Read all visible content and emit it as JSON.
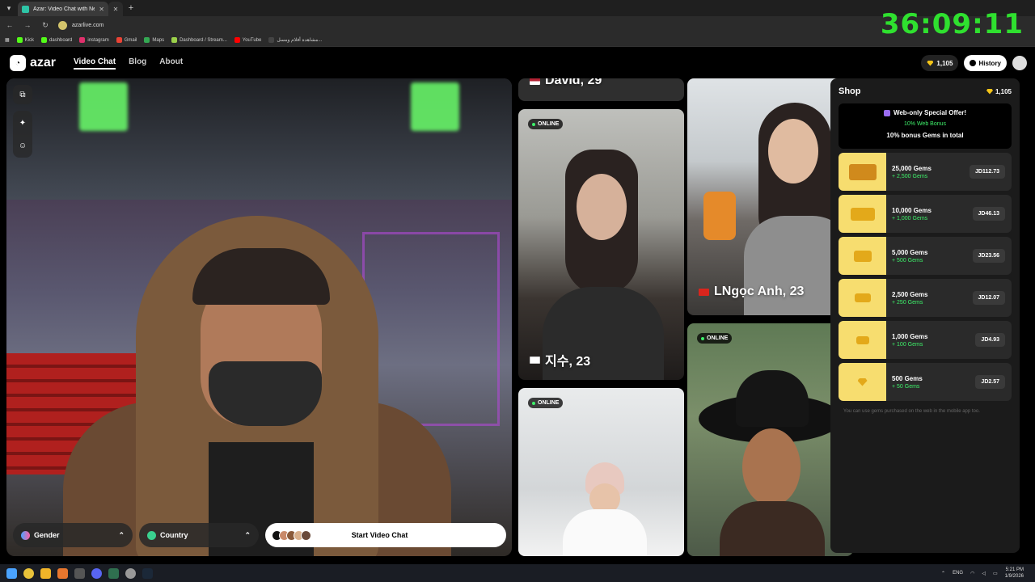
{
  "browser": {
    "tab_title": "Azar: Video Chat with New",
    "url": "azarlive.com",
    "bookmarks": [
      "Kick",
      "dashboard",
      "instagram",
      "Gmail",
      "Maps",
      "Dashboard / Stream...",
      "YouTube",
      "مشاهدة أفلام ومسل..."
    ]
  },
  "overlay_timer": "36:09:11",
  "site": {
    "logo": "azar",
    "nav": [
      "Video Chat",
      "Blog",
      "About"
    ],
    "gem_balance": "1,105",
    "history_label": "History"
  },
  "video": {
    "gender_label": "Gender",
    "country_label": "Country",
    "start_label": "Start Video Chat"
  },
  "profiles": [
    {
      "name": "David, 29",
      "online": "",
      "flag": "us"
    },
    {
      "name": "지수, 23",
      "online": "ONLINE",
      "flag": "kr"
    },
    {
      "name": "LNgọc Anh, 23",
      "online": "",
      "flag": "vn"
    },
    {
      "name": "",
      "online": "ONLINE",
      "flag": ""
    },
    {
      "name": "",
      "online": "ONLINE",
      "flag": ""
    }
  ],
  "shop": {
    "title": "Shop",
    "balance": "1,105",
    "offer_title": "Web-only Special Offer!",
    "offer_bonus": "10% Web Bonus",
    "offer_desc": "10% bonus Gems in total",
    "packages": [
      {
        "gems": "25,000 Gems",
        "bonus": "+ 2,500 Gems",
        "price": "JD112.73"
      },
      {
        "gems": "10,000 Gems",
        "bonus": "+ 1,000 Gems",
        "price": "JD46.13"
      },
      {
        "gems": "5,000 Gems",
        "bonus": "+ 500 Gems",
        "price": "JD23.56"
      },
      {
        "gems": "2,500 Gems",
        "bonus": "+ 250 Gems",
        "price": "JD12.07"
      },
      {
        "gems": "1,000 Gems",
        "bonus": "+ 100 Gems",
        "price": "JD4.93"
      },
      {
        "gems": "500 Gems",
        "bonus": "+ 50 Gems",
        "price": "JD2.57"
      }
    ],
    "note": "You can use gems purchased on the web in the mobile app too."
  },
  "taskbar": {
    "lang": "ENG",
    "time": "5:21 PM",
    "date": "1/9/2026"
  },
  "colors": {
    "online_green": "#3ef06a",
    "gem_gold": "#f5c518",
    "timer_green": "#2fe02f"
  }
}
